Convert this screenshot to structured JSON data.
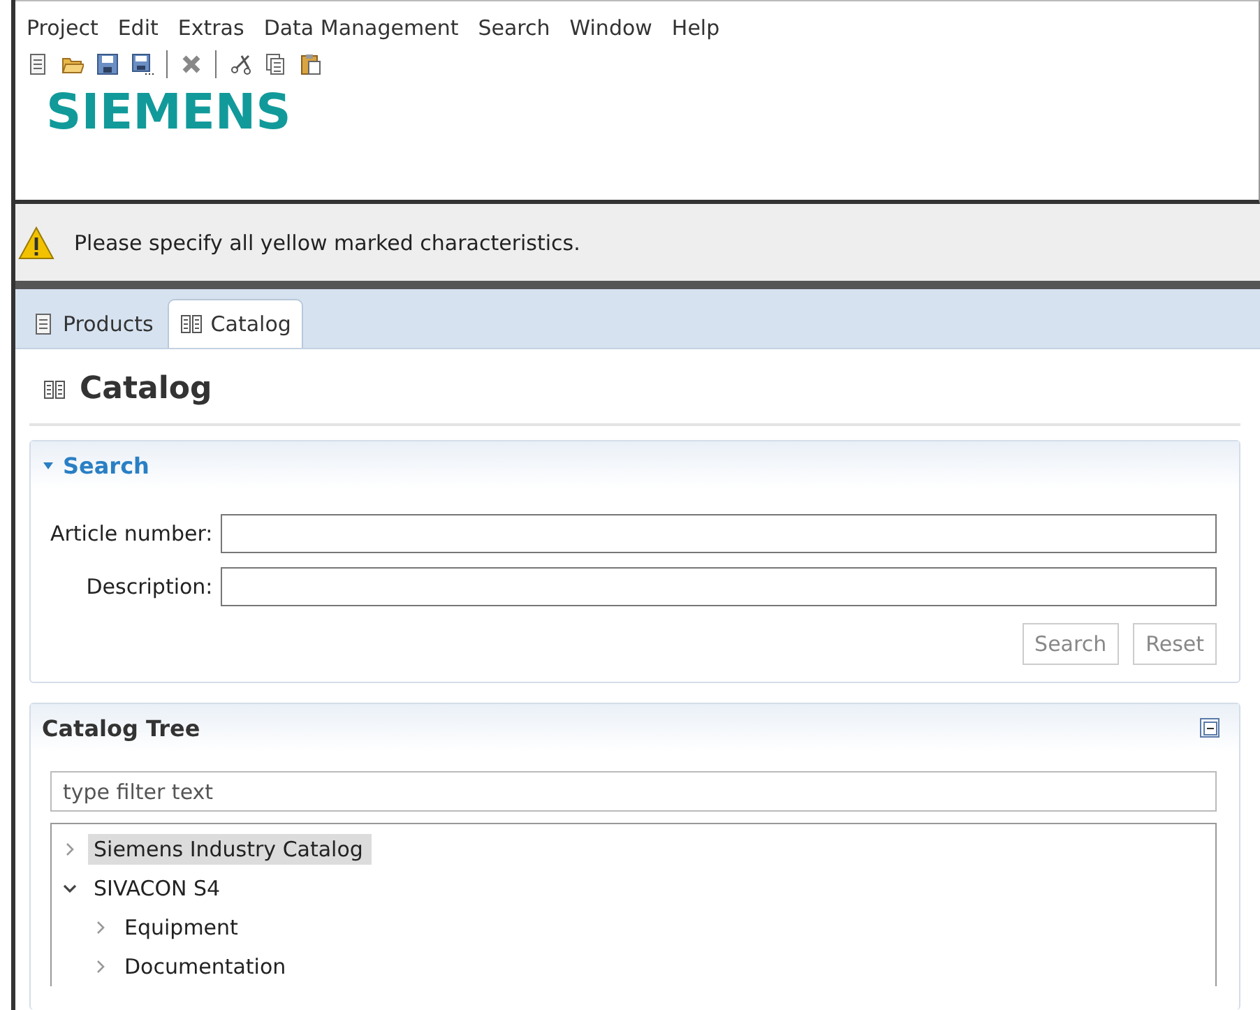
{
  "menu": [
    "Project",
    "Edit",
    "Extras",
    "Data Management",
    "Search",
    "Window",
    "Help"
  ],
  "toolbar": [
    {
      "kind": "new"
    },
    {
      "kind": "open"
    },
    {
      "kind": "save"
    },
    {
      "kind": "save-as"
    },
    {
      "kind": "separator"
    },
    {
      "kind": "delete"
    },
    {
      "kind": "separator"
    },
    {
      "kind": "cut"
    },
    {
      "kind": "copy"
    },
    {
      "kind": "paste"
    }
  ],
  "logo": "SIEMENS",
  "message": "Please specify all yellow marked characteristics.",
  "tabs": [
    {
      "label": "Products",
      "kind": "products",
      "selected": false
    },
    {
      "label": "Catalog",
      "kind": "catalog",
      "selected": true
    }
  ],
  "page_title": "Catalog",
  "search_section": {
    "title": "Search",
    "expanded": true,
    "fields": [
      {
        "label": "Article number:"
      },
      {
        "label": "Description:"
      }
    ],
    "buttons": [
      "Search",
      "Reset"
    ]
  },
  "tree_section": {
    "title": "Catalog Tree",
    "filter": {
      "placeholder": "type filter text"
    },
    "tree": [
      {
        "label": "Siemens Industry Catalog",
        "expanded": false,
        "selected": true
      },
      {
        "label": "SIVACON S4",
        "expanded": true,
        "selected": false,
        "children": [
          {
            "label": "Equipment",
            "expanded": false,
            "selected": false
          },
          {
            "label": "Documentation",
            "expanded": false,
            "selected": false
          }
        ]
      }
    ]
  }
}
